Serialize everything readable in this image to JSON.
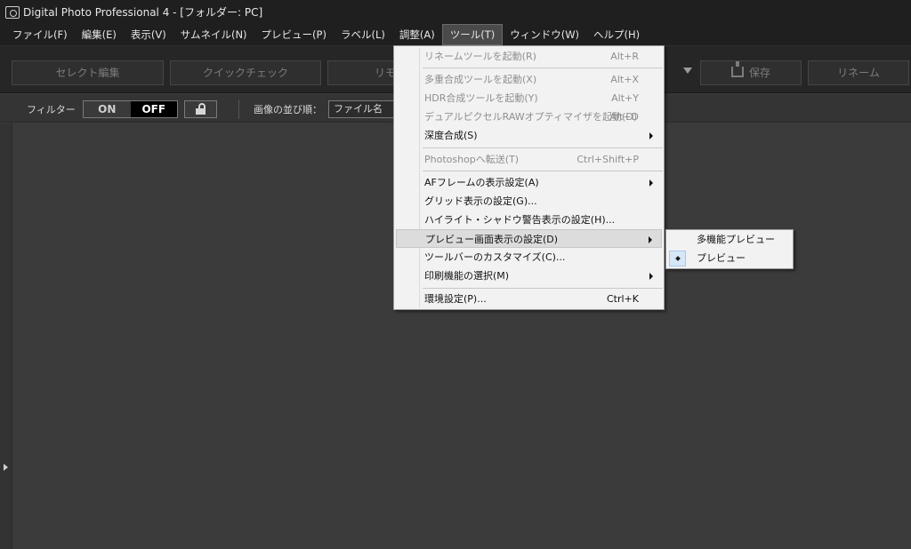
{
  "window": {
    "title": "Digital Photo Professional 4 - [フォルダー: PC]"
  },
  "menubar": {
    "items": [
      {
        "label": "ファイル(F)"
      },
      {
        "label": "編集(E)"
      },
      {
        "label": "表示(V)"
      },
      {
        "label": "サムネイル(N)"
      },
      {
        "label": "プレビュー(P)"
      },
      {
        "label": "ラベル(L)"
      },
      {
        "label": "調整(A)"
      },
      {
        "label": "ツール(T)",
        "active": true
      },
      {
        "label": "ウィンドウ(W)"
      },
      {
        "label": "ヘルプ(H)"
      }
    ]
  },
  "toolbar": {
    "select_edit": "セレクト編集",
    "quick_check": "クイックチェック",
    "remote_partial": "リモ",
    "save": "保存",
    "rename": "リネーム"
  },
  "filterbar": {
    "filter_label": "フィルター",
    "on": "ON",
    "off": "OFF",
    "sort_label": "画像の並び順：",
    "sort_value": "ファイル名"
  },
  "tools_menu": {
    "items": [
      {
        "label": "リネームツールを起動(R)",
        "shortcut": "Alt+R",
        "disabled": true
      },
      {
        "label": "多重合成ツールを起動(X)",
        "shortcut": "Alt+X",
        "disabled": true
      },
      {
        "label": "HDR合成ツールを起動(Y)",
        "shortcut": "Alt+Y",
        "disabled": true
      },
      {
        "label": "デュアルピクセルRAWオプティマイザを起動(D)",
        "shortcut": "Alt+D",
        "disabled": true
      },
      {
        "label": "深度合成(S)",
        "submenu": true
      },
      {
        "label": "Photoshopへ転送(T)",
        "shortcut": "Ctrl+Shift+P",
        "disabled": true
      },
      {
        "label": "AFフレームの表示設定(A)",
        "submenu": true
      },
      {
        "label": "グリッド表示の設定(G)..."
      },
      {
        "label": "ハイライト・シャドウ警告表示の設定(H)..."
      },
      {
        "label": "プレビュー画面表示の設定(D)",
        "submenu": true,
        "highlighted": true
      },
      {
        "label": "ツールバーのカスタマイズ(C)..."
      },
      {
        "label": "印刷機能の選択(M)",
        "submenu": true
      },
      {
        "label": "環境設定(P)...",
        "shortcut": "Ctrl+K"
      }
    ]
  },
  "preview_submenu": {
    "items": [
      {
        "label": "多機能プレビュー",
        "selected": false
      },
      {
        "label": "プレビュー",
        "selected": true
      }
    ]
  }
}
